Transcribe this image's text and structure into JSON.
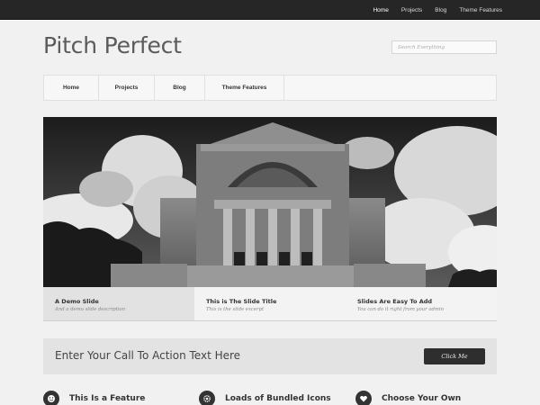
{
  "topnav": {
    "items": [
      "Home",
      "Projects",
      "Blog",
      "Theme Features"
    ]
  },
  "header": {
    "logo": "Pitch Perfect",
    "search_placeholder": "Search Everything"
  },
  "mainnav": {
    "items": [
      "Home",
      "Projects",
      "Blog",
      "Theme Features"
    ]
  },
  "slider": {
    "captions": [
      {
        "title": "A Demo Slide",
        "desc": "And a demo slide description"
      },
      {
        "title": "This is The Slide Title",
        "desc": "This is the slide excerpt"
      },
      {
        "title": "Slides Are Easy To Add",
        "desc": "You can do it right from your admin"
      }
    ]
  },
  "cta": {
    "text": "Enter Your Call To Action Text Here",
    "button": "Click Me"
  },
  "features": [
    {
      "title": "This Is a Feature",
      "icon": "smiley-icon"
    },
    {
      "title": "Loads of Bundled Icons",
      "icon": "gear-icon"
    },
    {
      "title": "Choose Your Own",
      "icon": "heart-icon"
    }
  ],
  "colors": {
    "topbar": "#262626",
    "background": "#f1f1f1",
    "button": "#2e2e2e"
  }
}
